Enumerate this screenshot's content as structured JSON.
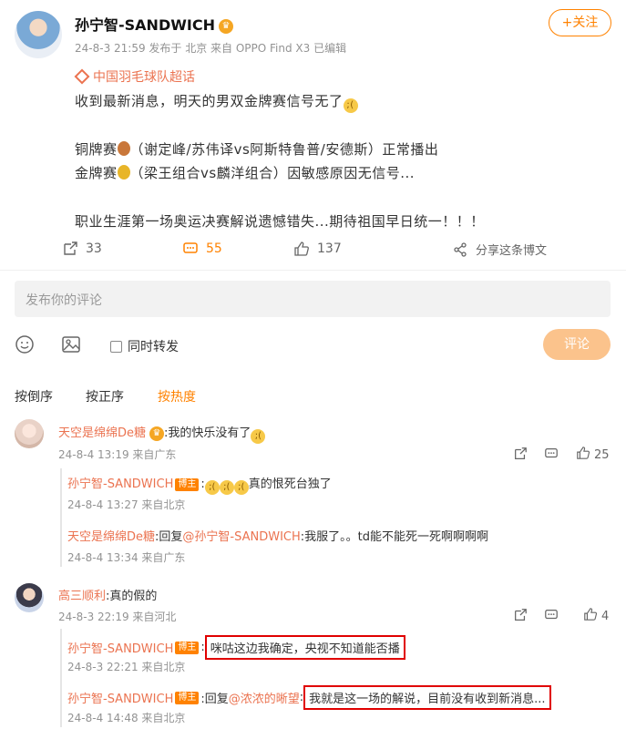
{
  "post": {
    "username": "孙宁智-SANDWICH",
    "meta": "24-8-3 21:59 发布于 北京 来自 OPPO Find X3 已编辑",
    "follow_label": "+关注",
    "topic": "中国羽毛球队超话",
    "line1": "收到最新消息，明天的男双金牌赛信号无了",
    "line2_pre": "铜牌赛",
    "line2_post": "（谢定峰/苏伟译vs阿斯特鲁普/安德斯）正常播出",
    "line3_pre": "金牌赛",
    "line3_post": "（梁王组合vs麟洋组合）因敏感原因无信号...",
    "line4": "职业生涯第一场奥运决赛解说遗憾错失...期待祖国早日统一！！！"
  },
  "actions": {
    "repost_count": "33",
    "comment_count": "55",
    "like_count": "137",
    "share_label": "分享这条博文"
  },
  "composer": {
    "placeholder": "发布你的评论",
    "repost_label": "同时转发",
    "submit_label": "评论"
  },
  "sort": {
    "tabs": [
      "按倒序",
      "按正序",
      "按热度"
    ]
  },
  "comments": [
    {
      "name": "天空是绵绵De糖",
      "text": ":我的快乐没有了",
      "meta": "24-8-4 13:19 来自广东",
      "likes": "25",
      "replies": [
        {
          "name": "孙宁智-SANDWICH",
          "badge": "博主",
          "text": "真的恨死台独了",
          "meta": "24-8-4 13:27 来自北京"
        },
        {
          "name": "天空是绵绵De糖",
          "prefix": ":回复",
          "mention": "@孙宁智-SANDWICH",
          "text": ":我服了。。td能不能死一死啊啊啊啊",
          "meta": "24-8-4 13:34 来自广东"
        }
      ]
    },
    {
      "name": "高三顺利",
      "text": ":真的假的",
      "meta": "24-8-3 22:19 来自河北",
      "likes": "4",
      "replies": [
        {
          "name": "孙宁智-SANDWICH",
          "badge": "博主",
          "text": "咪咕这边我确定，央视不知道能否播",
          "meta": "24-8-3 22:21 来自北京"
        },
        {
          "name": "孙宁智-SANDWICH",
          "badge": "博主",
          "prefix": ":回复",
          "mention": "@浓浓的晰望",
          "text": "我就是这一场的解说，目前没有收到新消息...",
          "meta": "24-8-4 14:48 来自北京"
        }
      ]
    }
  ]
}
